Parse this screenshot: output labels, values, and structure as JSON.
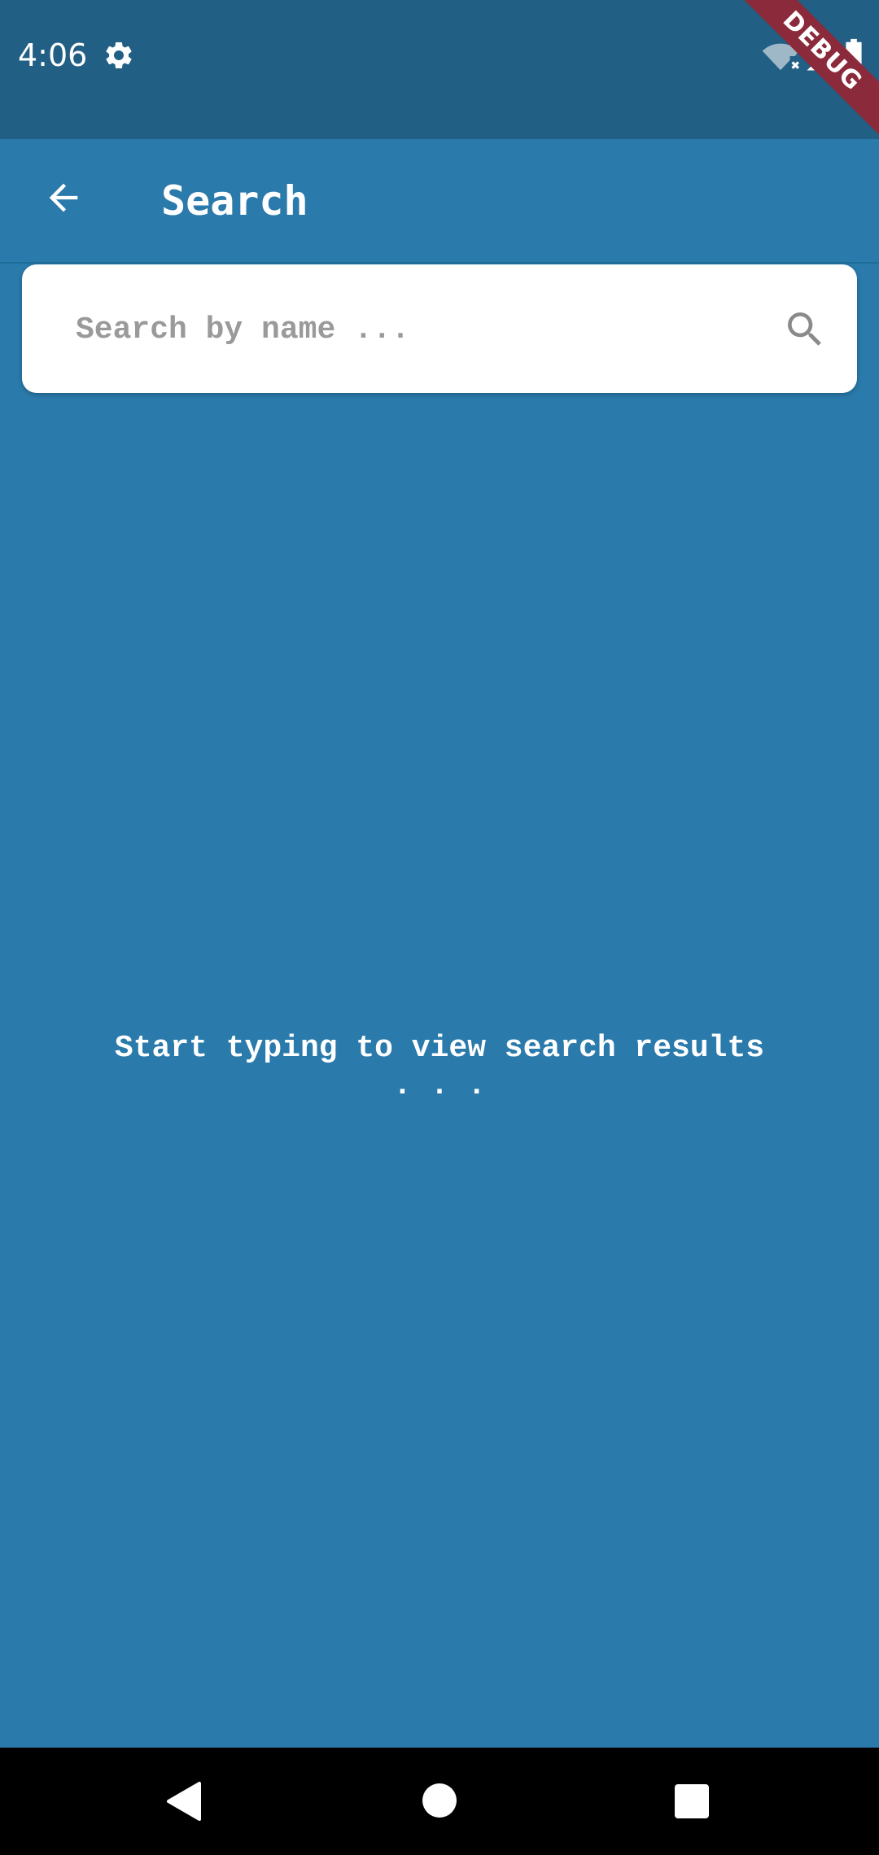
{
  "status_bar": {
    "time": "4:06",
    "icons": [
      "gear-icon",
      "wifi-off-icon",
      "signal-icon",
      "battery-icon"
    ]
  },
  "debug_banner": {
    "label": "DEBUG"
  },
  "app_bar": {
    "title": "Search",
    "back_icon": "arrow-back-icon"
  },
  "search": {
    "placeholder": "Search by name ...",
    "value": "",
    "icon": "search-icon"
  },
  "empty_state": {
    "message": "Start typing to view search results . . ."
  },
  "navigation_bar": {
    "buttons": [
      "nav-back-icon",
      "nav-home-icon",
      "nav-recents-icon"
    ]
  },
  "colors": {
    "status_bar": "#225f85",
    "primary": "#2a7aab",
    "card": "#ffffff",
    "placeholder": "#9a9a9a",
    "debug_ribbon": "#8a2a3a"
  }
}
